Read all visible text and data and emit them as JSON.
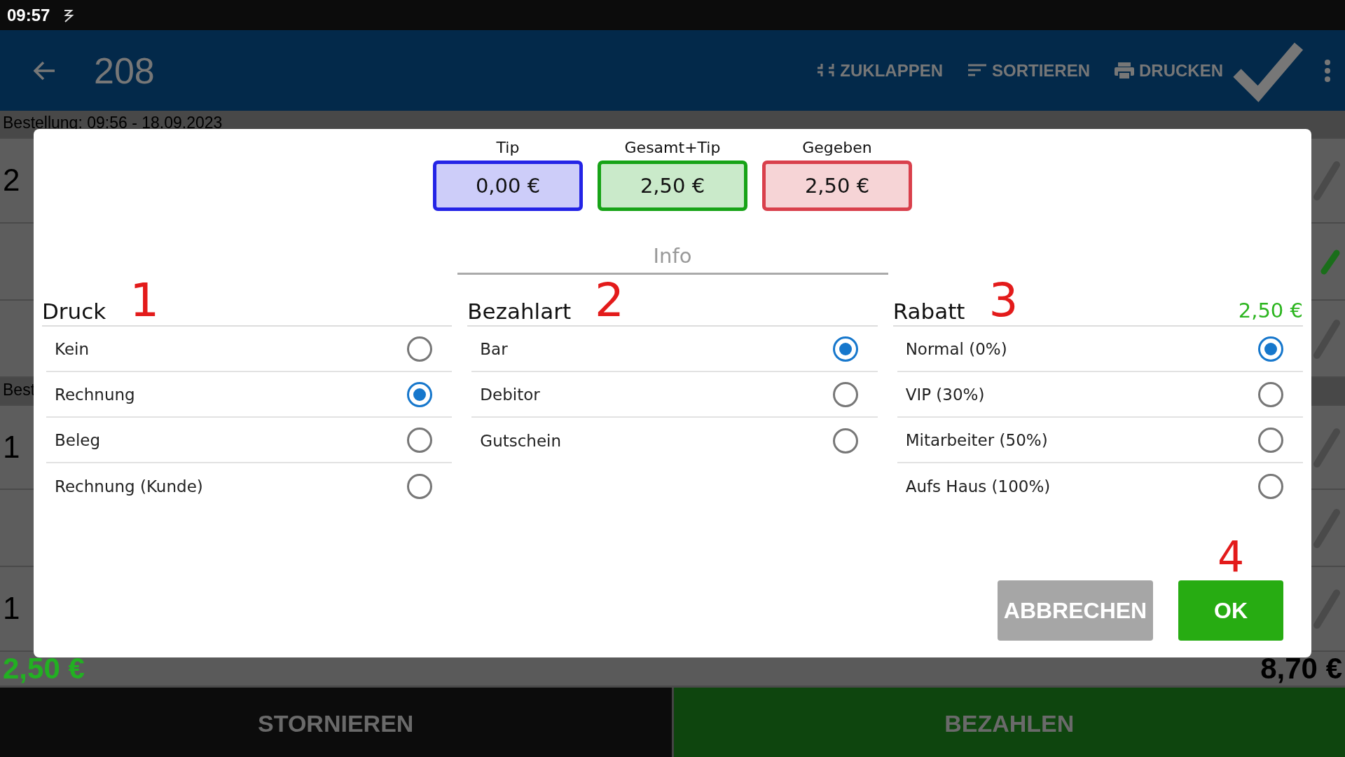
{
  "status_bar": {
    "time": "09:57"
  },
  "app_bar": {
    "title": "208",
    "actions": [
      {
        "kind": "collapse",
        "label": "ZUKLAPPEN"
      },
      {
        "kind": "sort",
        "label": "SORTIEREN"
      },
      {
        "kind": "print",
        "label": "DRUCKEN"
      }
    ]
  },
  "order": {
    "rows": [
      {
        "kind": "header",
        "text": "Bestellung: 09:56 - 18.09.2023"
      },
      {
        "kind": "item",
        "text": "2",
        "done": false
      },
      {
        "kind": "sub",
        "done": true
      },
      {
        "kind": "sub",
        "done": false
      },
      {
        "kind": "header",
        "text": "Best"
      },
      {
        "kind": "item",
        "text": "1",
        "done": false
      },
      {
        "kind": "sub",
        "done": false
      },
      {
        "kind": "item",
        "text": "1",
        "done": false
      }
    ],
    "paid_total": "2,50 €",
    "order_total": "8,70 €"
  },
  "dialog": {
    "amounts": [
      {
        "label": "Tip",
        "value": "0,00 €",
        "color": "#2424e6"
      },
      {
        "label": "Gesamt+Tip",
        "value": "2,50 €",
        "color": "#17a317"
      },
      {
        "label": "Gegeben",
        "value": "2,50 €",
        "color": "#d9404c"
      }
    ],
    "info": {
      "placeholder": "Info"
    },
    "groups": [
      {
        "title": "Druck",
        "annotation": "1",
        "options": [
          {
            "label": "Kein",
            "selected": false
          },
          {
            "label": "Rechnung",
            "selected": true
          },
          {
            "label": "Beleg",
            "selected": false
          },
          {
            "label": "Rechnung (Kunde)",
            "selected": false
          }
        ]
      },
      {
        "title": "Bezahlart",
        "annotation": "2",
        "options": [
          {
            "label": "Bar",
            "selected": true
          },
          {
            "label": "Debitor",
            "selected": false
          },
          {
            "label": "Gutschein",
            "selected": false
          }
        ]
      },
      {
        "title": "Rabatt",
        "annotation": "3",
        "total": "2,50 €",
        "options": [
          {
            "label": "Normal (0%)",
            "selected": true
          },
          {
            "label": "VIP (30%)",
            "selected": false
          },
          {
            "label": "Mitarbeiter (50%)",
            "selected": false
          },
          {
            "label": "Aufs Haus (100%)",
            "selected": false
          }
        ]
      }
    ],
    "button_annotation": "4",
    "buttons": [
      {
        "kind": "cancel",
        "label": "ABBRECHEN"
      },
      {
        "kind": "confirm",
        "label": "OK"
      }
    ]
  },
  "bottom_bar": {
    "buttons": [
      {
        "kind": "cancel",
        "label": "STORNIEREN"
      },
      {
        "kind": "pay",
        "label": "BEZAHLEN"
      }
    ]
  }
}
